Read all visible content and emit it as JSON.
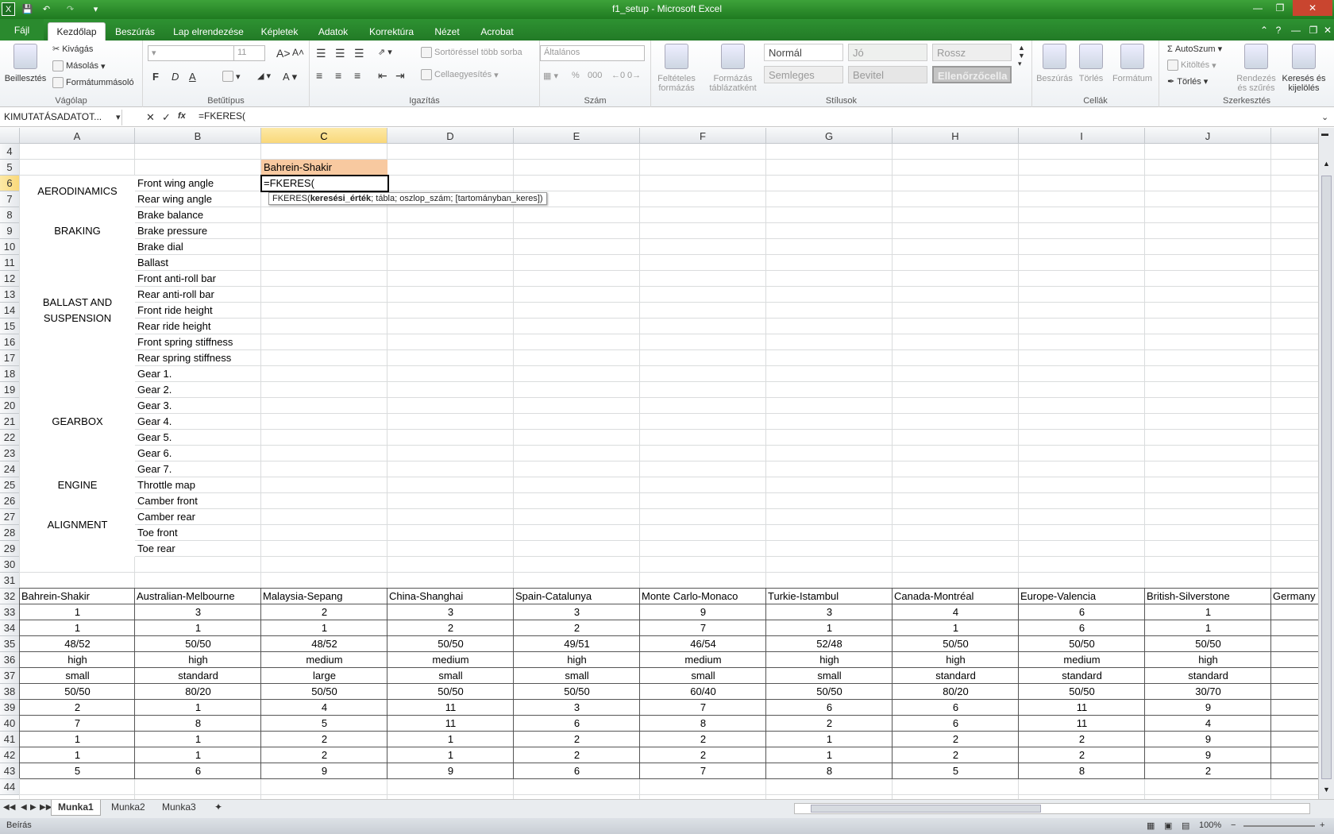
{
  "window": {
    "title": "f1_setup  -  Microsoft Excel"
  },
  "tabs": [
    "Fájl",
    "Kezdőlap",
    "Beszúrás",
    "Lap elrendezése",
    "Képletek",
    "Adatok",
    "Korrektúra",
    "Nézet",
    "Acrobat"
  ],
  "ribbon": {
    "clipboard": {
      "paste": "Beillesztés",
      "cut": "Kivágás",
      "copy": "Másolás",
      "format_painter": "Formátummásoló",
      "label": "Vágólap"
    },
    "font": {
      "size": "11",
      "bold": "F",
      "italic": "D",
      "underline": "A",
      "label": "Betűtípus"
    },
    "alignment": {
      "wrap": "Sortöréssel több sorba",
      "merge": "Cellaegyesítés",
      "label": "Igazítás"
    },
    "number": {
      "format": "Általános",
      "percent": "%",
      "thousands": "000",
      "label": "Szám"
    },
    "styles": {
      "conditional": "Feltételes formázás",
      "table": "Formázás táblázatként",
      "normal": "Normál",
      "good": "Jó",
      "bad": "Rossz",
      "neutral": "Semleges",
      "input": "Bevitel",
      "check": "Ellenőrzőcella",
      "label": "Stílusok"
    },
    "cells": {
      "insert": "Beszúrás",
      "delete": "Törlés",
      "format": "Formátum",
      "label": "Cellák"
    },
    "editing": {
      "autosum": "AutoSzum",
      "fill": "Kitöltés",
      "clear": "Törlés",
      "sort": "Rendezés és szűrés",
      "find": "Keresés és kijelölés",
      "label": "Szerkesztés"
    }
  },
  "formula_bar": {
    "name_box": "KIMUTATÁSADATOT...",
    "formula": "=FKERES("
  },
  "columns": [
    "A",
    "B",
    "C",
    "D",
    "E",
    "F",
    "G",
    "H",
    "I",
    "J"
  ],
  "rows": [
    "4",
    "5",
    "6",
    "7",
    "8",
    "9",
    "10",
    "11",
    "12",
    "13",
    "14",
    "15",
    "16",
    "17",
    "18",
    "19",
    "20",
    "21",
    "22",
    "23",
    "24",
    "25",
    "26",
    "27",
    "28",
    "29",
    "30",
    "31",
    "32",
    "33",
    "34",
    "35",
    "36",
    "37",
    "38",
    "39",
    "40",
    "41",
    "42",
    "43",
    "44"
  ],
  "cells": {
    "c5": "Bahrein-Shakir",
    "c6": "=FKERES(",
    "cat_aero": "AERODINAMICS",
    "cat_brake": "BRAKING",
    "cat_ballast1": "BALLAST AND",
    "cat_ballast2": "SUSPENSION",
    "cat_gear": "GEARBOX",
    "cat_engine": "ENGINE",
    "cat_align": "ALIGNMENT",
    "params": [
      "Front wing angle",
      "Rear wing angle",
      "Brake balance",
      "Brake pressure",
      "Brake dial",
      "Ballast",
      "Front anti-roll bar",
      "Rear anti-roll bar",
      "Front ride height",
      "Rear ride height",
      "Front spring stiffness",
      "Rear spring stiffness",
      "Gear 1.",
      "Gear 2.",
      "Gear 3.",
      "Gear 4.",
      "Gear 5.",
      "Gear 6.",
      "Gear 7.",
      "Throttle map",
      "Camber front",
      "Camber rear",
      "Toe front",
      "Toe rear"
    ]
  },
  "tooltip": {
    "fn": "FKERES(",
    "bold_arg": "keresési_érték",
    "rest": "; tábla; oszlop_szám; [tartományban_keres])"
  },
  "table": {
    "header": [
      "Bahrein-Shakir",
      "Australian-Melbourne",
      "Malaysia-Sepang",
      "China-Shanghai",
      "Spain-Catalunya",
      "Monte Carlo-Monaco",
      "Turkie-Istambul",
      "Canada-Montréal",
      "Europe-Valencia",
      "British-Silverstone",
      "Germany"
    ],
    "rows": [
      [
        "1",
        "3",
        "2",
        "3",
        "3",
        "9",
        "3",
        "4",
        "6",
        "1"
      ],
      [
        "1",
        "1",
        "1",
        "2",
        "2",
        "7",
        "1",
        "1",
        "6",
        "1"
      ],
      [
        "48/52",
        "50/50",
        "48/52",
        "50/50",
        "49/51",
        "46/54",
        "52/48",
        "50/50",
        "50/50",
        "50/50"
      ],
      [
        "high",
        "high",
        "medium",
        "medium",
        "high",
        "medium",
        "high",
        "high",
        "medium",
        "high"
      ],
      [
        "small",
        "standard",
        "large",
        "small",
        "small",
        "small",
        "small",
        "standard",
        "standard",
        "standard"
      ],
      [
        "50/50",
        "80/20",
        "50/50",
        "50/50",
        "50/50",
        "60/40",
        "50/50",
        "80/20",
        "50/50",
        "30/70"
      ],
      [
        "2",
        "1",
        "4",
        "11",
        "3",
        "7",
        "6",
        "6",
        "11",
        "9"
      ],
      [
        "7",
        "8",
        "5",
        "11",
        "6",
        "8",
        "2",
        "6",
        "11",
        "4"
      ],
      [
        "1",
        "1",
        "2",
        "1",
        "2",
        "2",
        "1",
        "2",
        "2",
        "9"
      ],
      [
        "1",
        "1",
        "2",
        "1",
        "2",
        "2",
        "1",
        "2",
        "2",
        "9"
      ],
      [
        "5",
        "6",
        "9",
        "9",
        "6",
        "7",
        "8",
        "5",
        "8",
        "2"
      ]
    ]
  },
  "sheets": [
    "Munka1",
    "Munka2",
    "Munka3"
  ],
  "status": {
    "mode": "Beírás",
    "zoom": "100%"
  }
}
